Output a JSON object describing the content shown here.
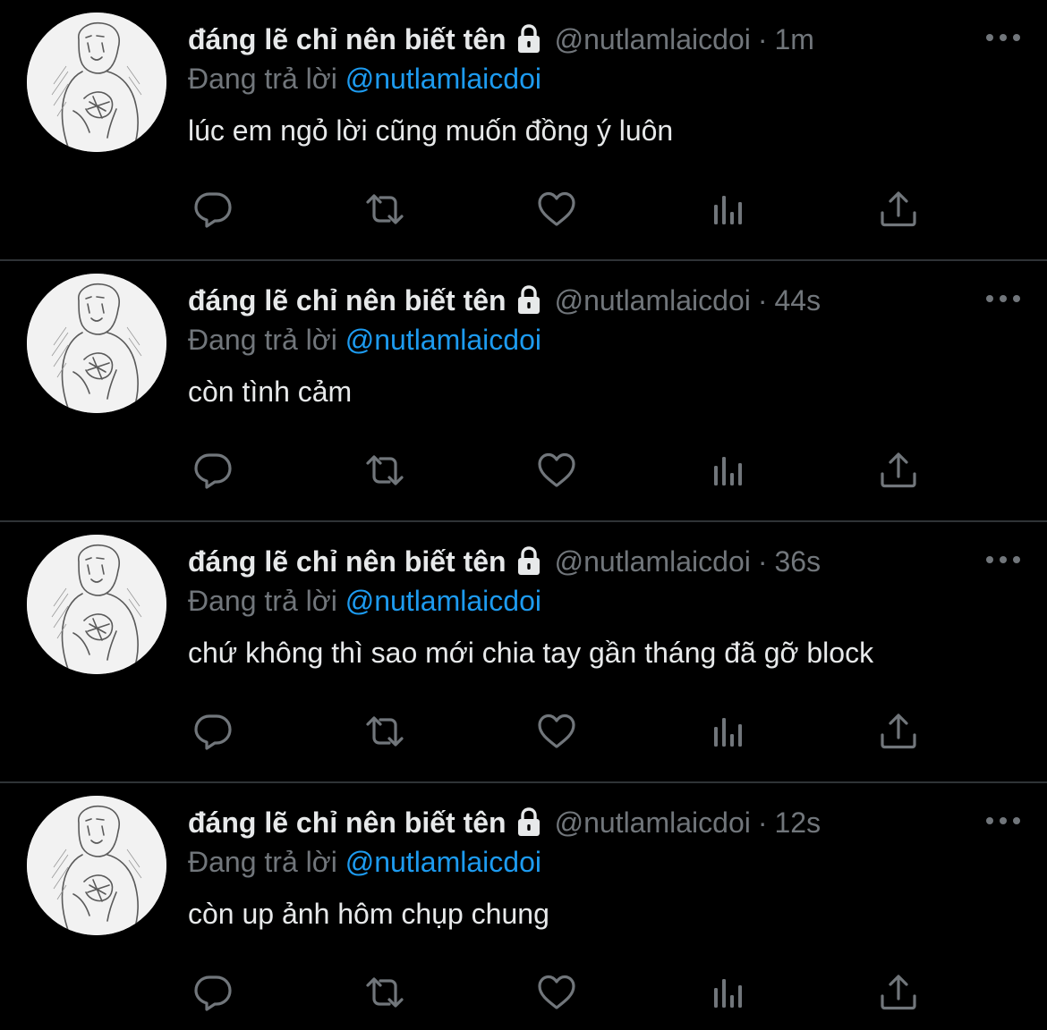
{
  "colors": {
    "background": "#000000",
    "primary_text": "#e7e9ea",
    "secondary_text": "#71767b",
    "accent": "#1d9bf0",
    "divider": "#2f3336"
  },
  "icons": {
    "more": "more-horizontal-icon",
    "lock": "lock-icon",
    "reply": "reply-icon",
    "retweet": "retweet-icon",
    "like": "heart-icon",
    "views": "bar-chart-icon",
    "share": "share-icon"
  },
  "tweets": [
    {
      "display_name": "đáng lẽ chỉ nên biết tên",
      "handle": "@nutlamlaicdoi",
      "separator": "·",
      "time": "1m",
      "reply_prefix": "Đang trả lời",
      "reply_to": "@nutlamlaicdoi",
      "text": "lúc em ngỏ lời cũng muốn đồng ý luôn"
    },
    {
      "display_name": "đáng lẽ chỉ nên biết tên",
      "handle": "@nutlamlaicdoi",
      "separator": "·",
      "time": "44s",
      "reply_prefix": "Đang trả lời",
      "reply_to": "@nutlamlaicdoi",
      "text": "còn tình cảm"
    },
    {
      "display_name": "đáng lẽ chỉ nên biết tên",
      "handle": "@nutlamlaicdoi",
      "separator": "·",
      "time": "36s",
      "reply_prefix": "Đang trả lời",
      "reply_to": "@nutlamlaicdoi",
      "text": "chứ không thì sao mới chia tay gần tháng đã gỡ block"
    },
    {
      "display_name": "đáng lẽ chỉ nên biết tên",
      "handle": "@nutlamlaicdoi",
      "separator": "·",
      "time": "12s",
      "reply_prefix": "Đang trả lời",
      "reply_to": "@nutlamlaicdoi",
      "text": "còn up ảnh hôm chụp chung"
    }
  ]
}
